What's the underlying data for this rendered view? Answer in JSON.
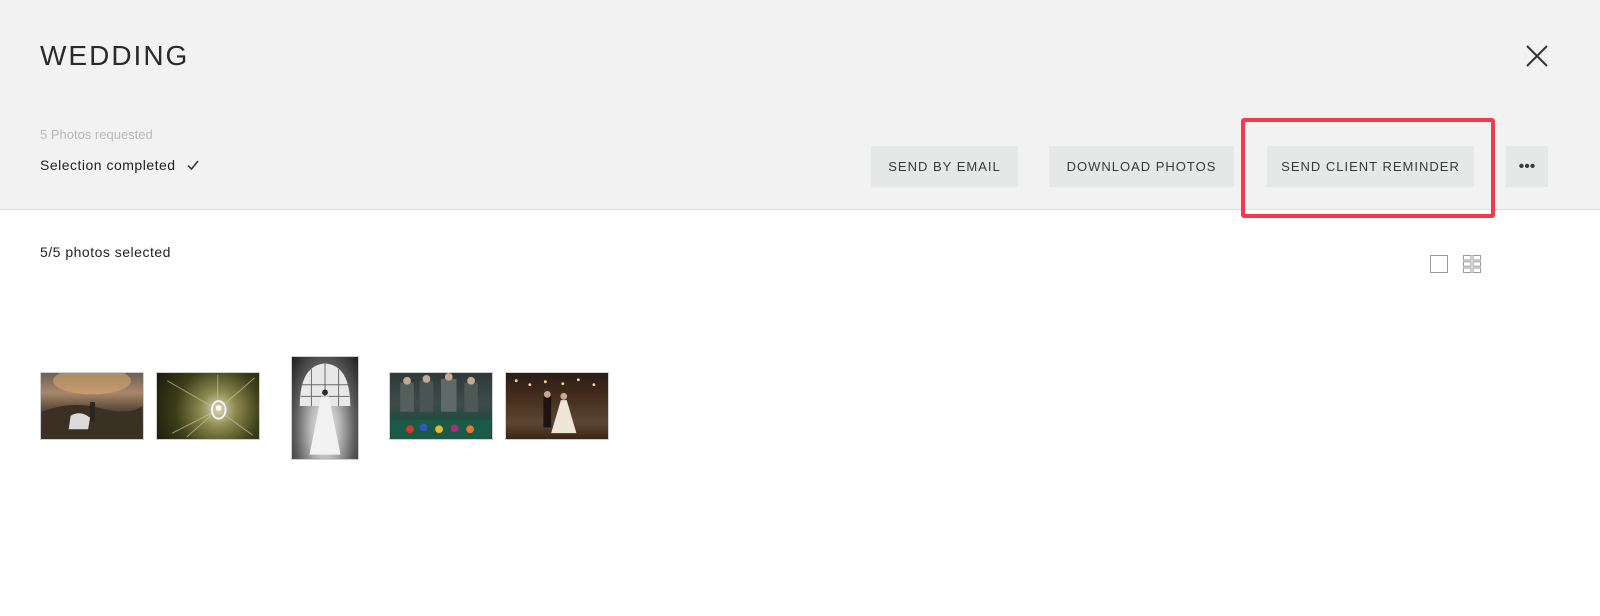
{
  "header": {
    "title": "WEDDING",
    "requested": "5 Photos requested",
    "status": "Selection completed",
    "buttons": {
      "send_email": "SEND BY EMAIL",
      "download": "DOWNLOAD PHOTOS",
      "reminder": "SEND CLIENT REMINDER",
      "more": "•••"
    }
  },
  "gallery": {
    "count": "5/5 photos selected",
    "photos": [
      {
        "id": 1,
        "subject": "couple on hillside at sunset"
      },
      {
        "id": 2,
        "subject": "engagement ring on plant"
      },
      {
        "id": 3,
        "subject": "bride in front of window"
      },
      {
        "id": 4,
        "subject": "groomsmen at pool table"
      },
      {
        "id": 5,
        "subject": "couple walking under string lights"
      }
    ]
  },
  "icons": {
    "close": "close-icon",
    "check": "check-icon",
    "single_view": "single-view-icon",
    "grid_view": "grid-view-icon"
  },
  "colors": {
    "highlight": "#f23a4c",
    "header_bg": "#f2f2f2",
    "button_bg": "#e6e7e7"
  }
}
